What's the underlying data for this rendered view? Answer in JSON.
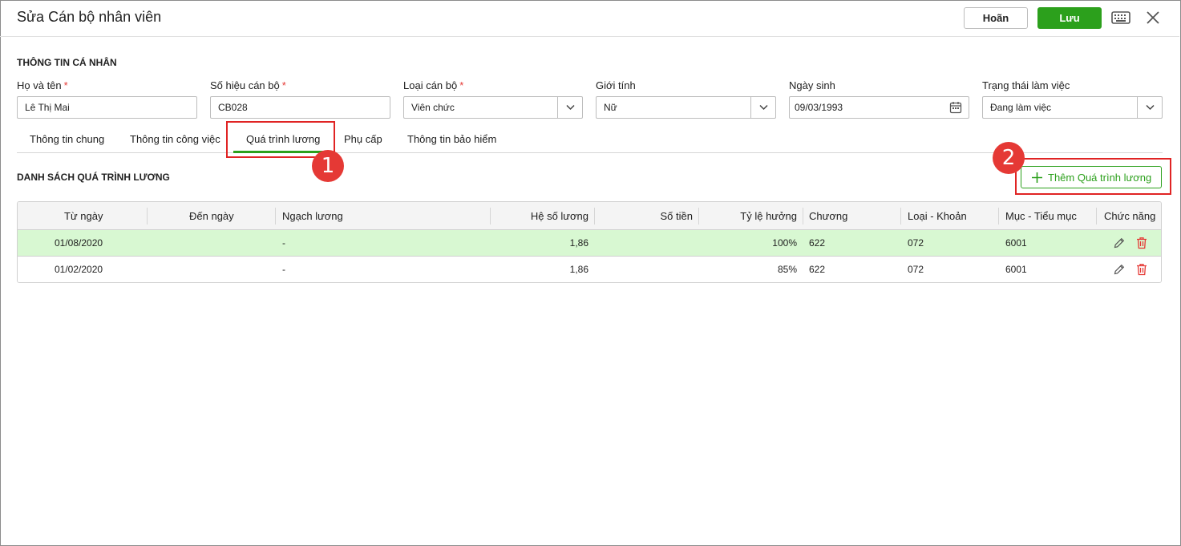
{
  "header": {
    "title": "Sửa Cán bộ nhân viên",
    "cancel_label": "Hoãn",
    "save_label": "Lưu"
  },
  "personal": {
    "section_title": "THÔNG TIN CÁ NHÂN",
    "fields": [
      {
        "label": "Họ và tên",
        "required": true,
        "value": "Lê Thị Mai"
      },
      {
        "label": "Số hiệu cán bộ",
        "required": true,
        "value": "CB028"
      },
      {
        "label": "Loại cán bộ",
        "required": true,
        "value": "Viên chức"
      },
      {
        "label": "Giới tính",
        "required": false,
        "value": "Nữ"
      },
      {
        "label": "Ngày sinh",
        "required": false,
        "value": "09/03/1993"
      },
      {
        "label": "Trạng thái làm việc",
        "required": false,
        "value": "Đang làm việc"
      }
    ],
    "required_mark": "*"
  },
  "tabs": [
    {
      "label": "Thông tin chung"
    },
    {
      "label": "Thông tin công việc"
    },
    {
      "label": "Quá trình lương",
      "active": true
    },
    {
      "label": "Phụ cấp"
    },
    {
      "label": "Thông tin bảo hiểm"
    }
  ],
  "annotations": {
    "badge1": "1",
    "badge2": "2"
  },
  "salary": {
    "list_title": "DANH SÁCH QUÁ TRÌNH LƯƠNG",
    "add_label": "Thêm Quá trình lương",
    "columns": [
      "Từ ngày",
      "Đến ngày",
      "Ngạch lương",
      "Hệ số lương",
      "Số tiền",
      "Tỷ lệ hưởng",
      "Chương",
      "Loại - Khoản",
      "Mục - Tiểu mục",
      "Chức năng"
    ],
    "rows": [
      [
        "01/08/2020",
        "",
        "-",
        "1,86",
        "",
        "100%",
        "622",
        "072",
        "6001"
      ],
      [
        "01/02/2020",
        "",
        "-",
        "1,86",
        "",
        "85%",
        "622",
        "072",
        "6001"
      ]
    ]
  },
  "colors": {
    "accent": "#2ca01c",
    "selected_row": "#d8f8d2",
    "highlight": "#e02424",
    "delete": "#e53935"
  }
}
